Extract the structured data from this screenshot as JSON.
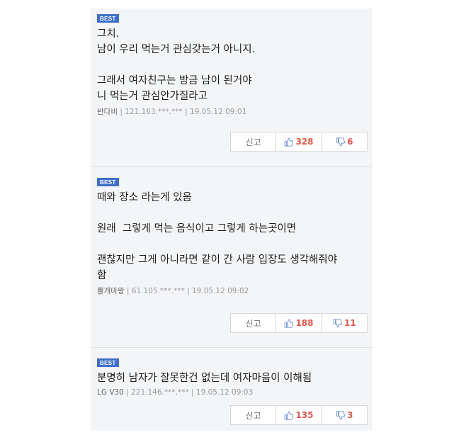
{
  "comments": [
    {
      "badge": "BEST",
      "lines": [
        "그치.",
        "남이 우리 먹는거 관심갖는거 아니지.",
        "",
        "그래서 여자친구는 방금 남이 된거야",
        "니 먹는거 관심안가질라고"
      ],
      "nick": "반다비",
      "ip": "121.163.***.***",
      "date": "19.05.12 09:01",
      "report_label": "신고",
      "likes": "328",
      "dislikes": "6"
    },
    {
      "badge": "BEST",
      "lines": [
        "때와 장소 라는게 있음",
        "",
        "원래  그렇게 먹는 음식이고 그렇게 하는곳이면",
        "",
        "괜찮지만 그게 아니라면 같이 간 사람 입장도 생각해줘야",
        "함"
      ],
      "nick": "뿔개마왕",
      "ip": "61.105.***.***",
      "date": "19.05.12 09:02",
      "report_label": "신고",
      "likes": "188",
      "dislikes": "11"
    },
    {
      "badge": "BEST",
      "lines": [
        "분명히 남자가 잘못한건 없는데 여자마음이 이해됨"
      ],
      "nick": "LG V30",
      "ip": "221.146.***.***",
      "date": "19.05.12 09:03",
      "report_label": "신고",
      "likes": "135",
      "dislikes": "3"
    }
  ],
  "colors": {
    "badge": "#3f6fc9",
    "count": "#e0584c",
    "background": "#f4f5f7"
  },
  "icons": {
    "like": "thumbs-up-icon",
    "dislike": "thumbs-down-icon"
  }
}
